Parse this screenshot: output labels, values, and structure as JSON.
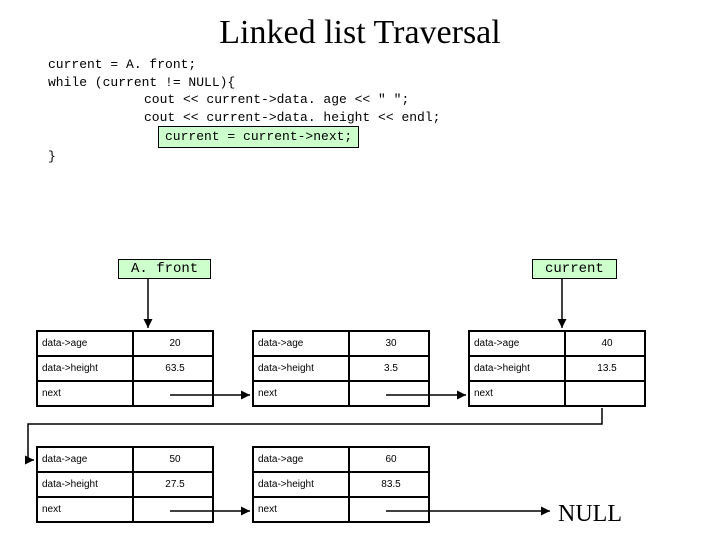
{
  "title": "Linked list Traversal",
  "code": {
    "l1": "current = A. front;",
    "l2": "while (current != NULL){",
    "l3": "cout << current->data. age << \"   \";",
    "l4": "cout << current->data. height << endl;",
    "l5": "current = current->next;",
    "l6": "}"
  },
  "labels": {
    "front": "A. front",
    "current": "current",
    "null": "NULL",
    "age": "data->age",
    "height": "data->height",
    "next": "next"
  },
  "nodes": [
    {
      "age": "20",
      "height": "63.5"
    },
    {
      "age": "30",
      "height": "3.5"
    },
    {
      "age": "40",
      "height": "13.5"
    },
    {
      "age": "50",
      "height": "27.5"
    },
    {
      "age": "60",
      "height": "83.5"
    }
  ]
}
